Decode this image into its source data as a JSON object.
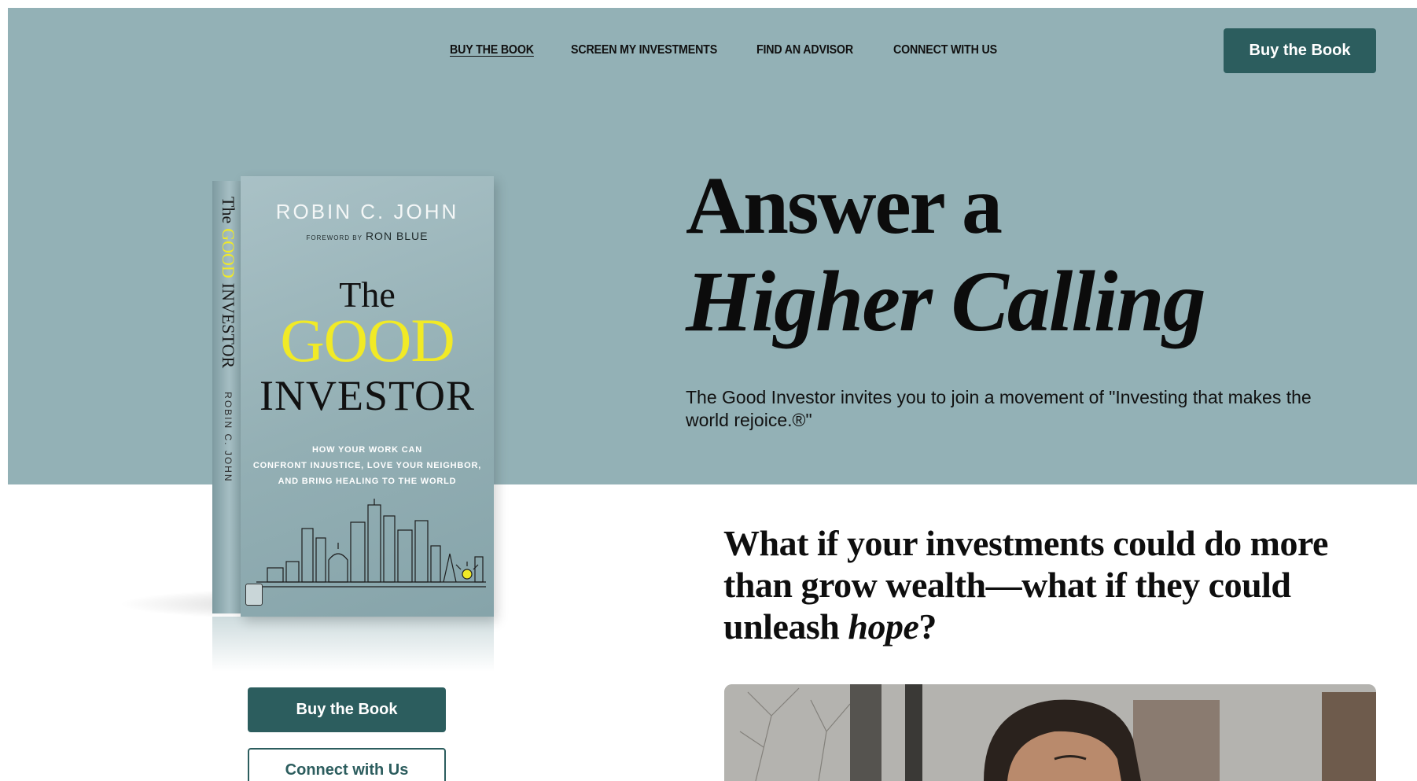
{
  "nav": {
    "links": [
      {
        "label": "BUY THE BOOK",
        "active": true
      },
      {
        "label": "SCREEN MY INVESTMENTS",
        "active": false
      },
      {
        "label": "FIND AN ADVISOR",
        "active": false
      },
      {
        "label": "CONNECT WITH US",
        "active": false
      }
    ],
    "cta_label": "Buy the Book"
  },
  "hero": {
    "title_line1": "Answer a",
    "title_line2": "Higher Calling",
    "subtitle": "The Good Investor invites you to join a movement of \"Investing that makes the world rejoice.®\""
  },
  "book": {
    "author": "ROBIN C. JOHN",
    "foreword_prefix": "FOREWORD BY",
    "foreword_name": "RON BLUE",
    "title_the": "The",
    "title_good": "GOOD",
    "title_investor": "INVESTOR",
    "tagline": [
      "HOW YOUR WORK CAN",
      "CONFRONT INJUSTICE, LOVE YOUR NEIGHBOR,",
      "AND BRING HEALING TO THE WORLD"
    ],
    "spine_the": "The",
    "spine_good": "GOOD",
    "spine_investor": "INVESTOR",
    "spine_author": "ROBIN C. JOHN"
  },
  "actions": {
    "buy_label": "Buy the Book",
    "connect_label": "Connect with Us"
  },
  "question": {
    "text_before": "What if your investments could do more than grow wealth—what if they could unleash ",
    "emphasis": "hope",
    "text_after": "?"
  },
  "colors": {
    "hero_band": "#93b1b6",
    "brand_green": "#2c5d5e",
    "title_yellow": "#f1ea26"
  }
}
